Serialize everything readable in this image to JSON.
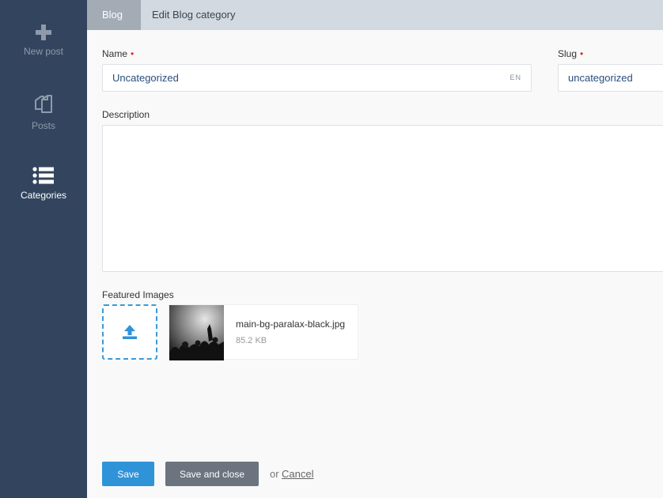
{
  "sidebar": {
    "items": [
      {
        "label": "New post",
        "icon": "plus-icon",
        "active": false
      },
      {
        "label": "Posts",
        "icon": "documents-icon",
        "active": false
      },
      {
        "label": "Categories",
        "icon": "list-icon",
        "active": true
      }
    ]
  },
  "breadcrumb": {
    "parent": "Blog",
    "current": "Edit Blog category"
  },
  "form": {
    "name": {
      "label": "Name",
      "value": "Uncategorized",
      "lang": "EN",
      "required": "•"
    },
    "slug": {
      "label": "Slug",
      "value": "uncategorized",
      "required": "•"
    },
    "description": {
      "label": "Description",
      "value": ""
    },
    "featured_images": {
      "label": "Featured Images",
      "files": [
        {
          "name": "main-bg-paralax-black.jpg",
          "size": "85.2 KB"
        }
      ]
    }
  },
  "actions": {
    "save": "Save",
    "save_close": "Save and close",
    "or": "or",
    "cancel": "Cancel"
  },
  "colors": {
    "sidebar": "#33455e",
    "primary": "#2f93d8",
    "secondary": "#6b747f",
    "required": "#dd2222"
  }
}
